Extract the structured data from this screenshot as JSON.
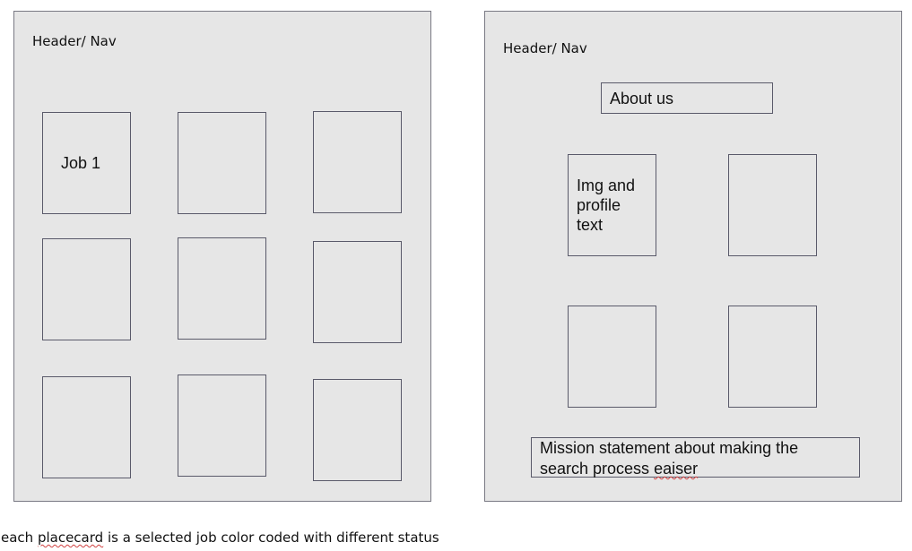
{
  "left_frame": {
    "header_label": "Header/ Nav",
    "job_card_1_label": "Job 1"
  },
  "right_frame": {
    "header_label": "Header/ Nav",
    "about_label": "About us",
    "profile_card_label": "Img and profile text",
    "mission_text_before": "Mission statement about making the search process ",
    "mission_text_misspelled": "eaiser"
  },
  "caption": {
    "text_before": "each ",
    "text_misspelled": "placecard",
    "text_after": " is a selected job color coded with different status"
  }
}
